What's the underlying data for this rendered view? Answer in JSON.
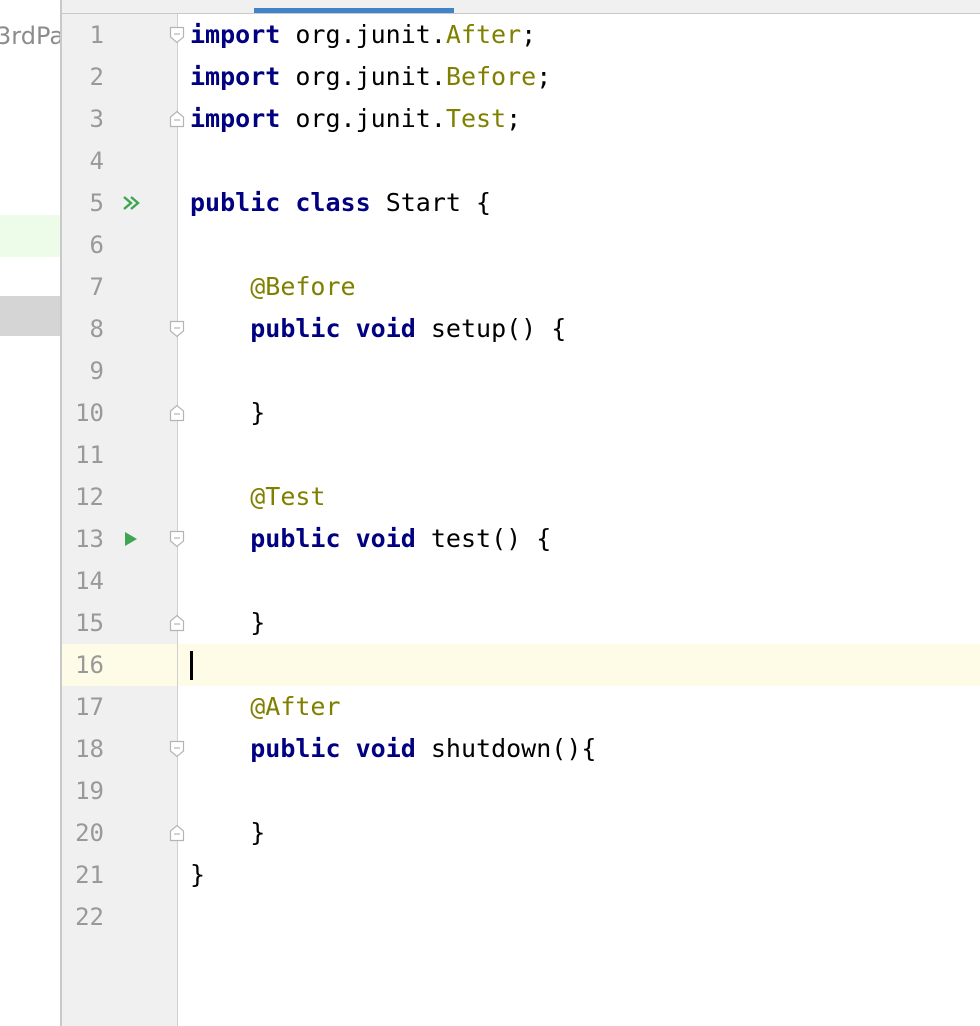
{
  "project_pane": {
    "visible_text": "3rdPa"
  },
  "colors": {
    "keyword": "#000080",
    "annotation": "#808000",
    "class_ref": "#808000",
    "line_number": "#999999",
    "gutter_bg": "#f0f0f0",
    "current_line_bg": "#fefbe7",
    "run_icon": "#3fa552",
    "tab_indicator": "#4083c9"
  },
  "editor": {
    "current_line": 16,
    "lines": [
      {
        "num": "1",
        "fold": "start",
        "run": "",
        "tokens": [
          {
            "t": "import",
            "c": "kw"
          },
          {
            "t": " org.junit.",
            "c": ""
          },
          {
            "t": "After",
            "c": "cls"
          },
          {
            "t": ";",
            "c": ""
          }
        ]
      },
      {
        "num": "2",
        "fold": "",
        "run": "",
        "tokens": [
          {
            "t": "import",
            "c": "kw"
          },
          {
            "t": " org.junit.",
            "c": ""
          },
          {
            "t": "Before",
            "c": "cls"
          },
          {
            "t": ";",
            "c": ""
          }
        ]
      },
      {
        "num": "3",
        "fold": "end",
        "run": "",
        "tokens": [
          {
            "t": "import",
            "c": "kw"
          },
          {
            "t": " org.junit.",
            "c": ""
          },
          {
            "t": "Test",
            "c": "cls"
          },
          {
            "t": ";",
            "c": ""
          }
        ]
      },
      {
        "num": "4",
        "fold": "",
        "run": "",
        "tokens": []
      },
      {
        "num": "5",
        "fold": "",
        "run": "double",
        "tokens": [
          {
            "t": "public",
            "c": "kw"
          },
          {
            "t": " ",
            "c": ""
          },
          {
            "t": "class",
            "c": "kw"
          },
          {
            "t": " Start {",
            "c": ""
          }
        ]
      },
      {
        "num": "6",
        "fold": "",
        "run": "",
        "tokens": []
      },
      {
        "num": "7",
        "fold": "",
        "run": "",
        "tokens": [
          {
            "t": "    ",
            "c": ""
          },
          {
            "t": "@Before",
            "c": "ann"
          }
        ]
      },
      {
        "num": "8",
        "fold": "start",
        "run": "",
        "tokens": [
          {
            "t": "    ",
            "c": ""
          },
          {
            "t": "public",
            "c": "kw"
          },
          {
            "t": " ",
            "c": ""
          },
          {
            "t": "void",
            "c": "kw"
          },
          {
            "t": " setup() {",
            "c": ""
          }
        ]
      },
      {
        "num": "9",
        "fold": "",
        "run": "",
        "tokens": []
      },
      {
        "num": "10",
        "fold": "end",
        "run": "",
        "tokens": [
          {
            "t": "    }",
            "c": ""
          }
        ]
      },
      {
        "num": "11",
        "fold": "",
        "run": "",
        "tokens": []
      },
      {
        "num": "12",
        "fold": "",
        "run": "",
        "tokens": [
          {
            "t": "    ",
            "c": ""
          },
          {
            "t": "@Test",
            "c": "ann"
          }
        ]
      },
      {
        "num": "13",
        "fold": "start",
        "run": "single",
        "tokens": [
          {
            "t": "    ",
            "c": ""
          },
          {
            "t": "public",
            "c": "kw"
          },
          {
            "t": " ",
            "c": ""
          },
          {
            "t": "void",
            "c": "kw"
          },
          {
            "t": " test() {",
            "c": ""
          }
        ]
      },
      {
        "num": "14",
        "fold": "",
        "run": "",
        "tokens": []
      },
      {
        "num": "15",
        "fold": "end",
        "run": "",
        "tokens": [
          {
            "t": "    }",
            "c": ""
          }
        ]
      },
      {
        "num": "16",
        "fold": "",
        "run": "",
        "tokens": []
      },
      {
        "num": "17",
        "fold": "",
        "run": "",
        "tokens": [
          {
            "t": "    ",
            "c": ""
          },
          {
            "t": "@After",
            "c": "ann"
          }
        ]
      },
      {
        "num": "18",
        "fold": "start",
        "run": "",
        "tokens": [
          {
            "t": "    ",
            "c": ""
          },
          {
            "t": "public",
            "c": "kw"
          },
          {
            "t": " ",
            "c": ""
          },
          {
            "t": "void",
            "c": "kw"
          },
          {
            "t": " shutdown(){",
            "c": ""
          }
        ]
      },
      {
        "num": "19",
        "fold": "",
        "run": "",
        "tokens": []
      },
      {
        "num": "20",
        "fold": "end",
        "run": "",
        "tokens": [
          {
            "t": "    }",
            "c": ""
          }
        ]
      },
      {
        "num": "21",
        "fold": "",
        "run": "",
        "tokens": [
          {
            "t": "}",
            "c": ""
          }
        ]
      },
      {
        "num": "22",
        "fold": "",
        "run": "",
        "tokens": []
      }
    ]
  }
}
